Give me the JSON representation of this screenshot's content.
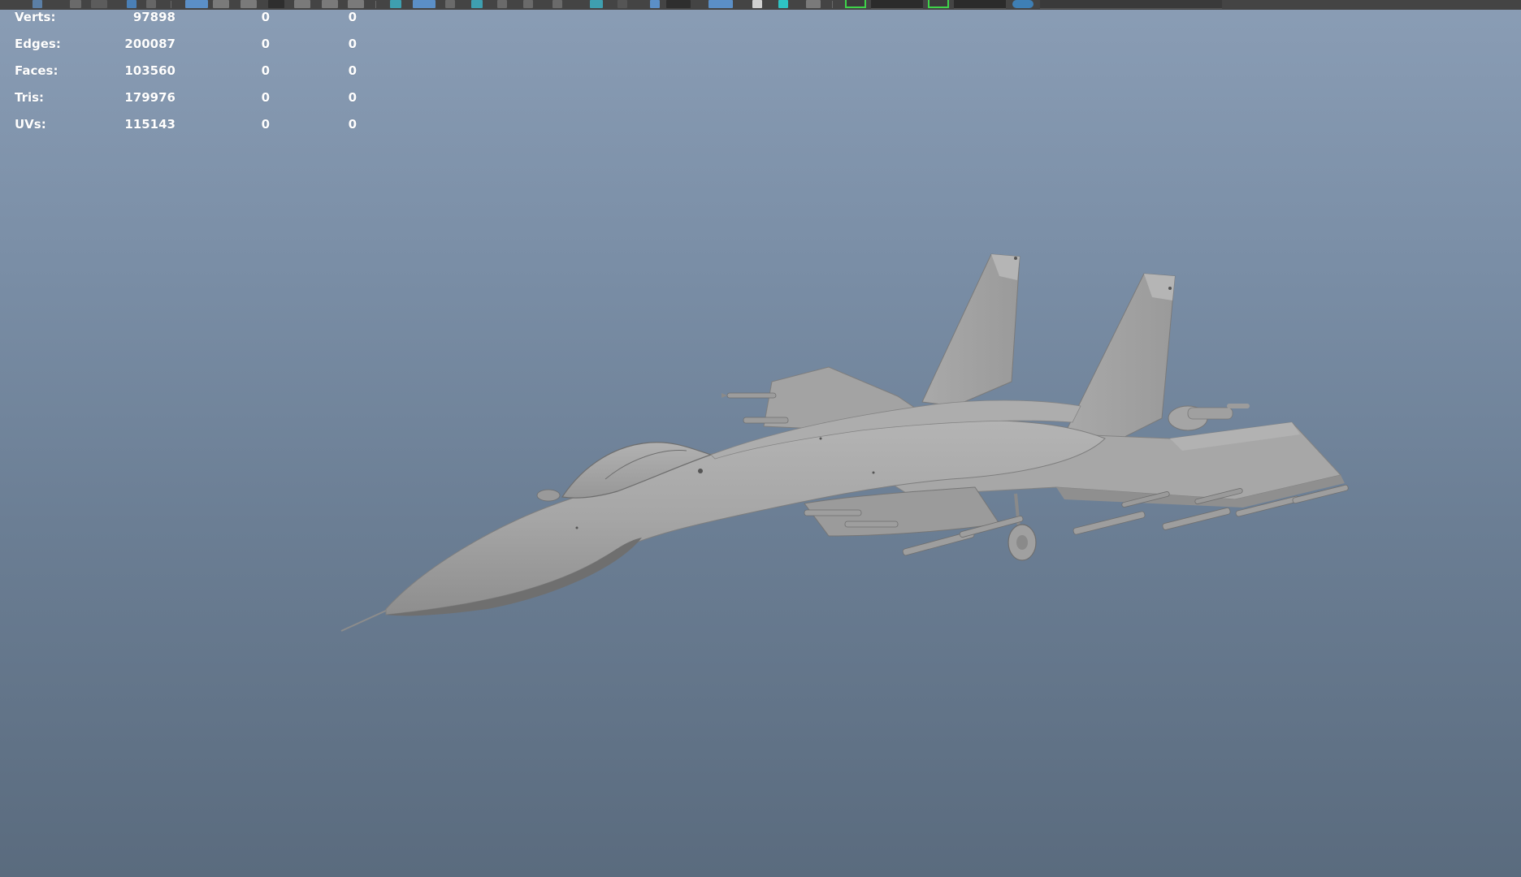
{
  "hud": {
    "rows": [
      {
        "label": "Verts:",
        "v1": "97898",
        "v2": "0",
        "v3": "0"
      },
      {
        "label": "Edges:",
        "v1": "200087",
        "v2": "0",
        "v3": "0"
      },
      {
        "label": "Faces:",
        "v1": "103560",
        "v2": "0",
        "v3": "0"
      },
      {
        "label": "Tris:",
        "v1": "179976",
        "v2": "0",
        "v3": "0"
      },
      {
        "label": "UVs:",
        "v1": "115143",
        "v2": "0",
        "v3": "0"
      }
    ]
  },
  "colors": {
    "viewport_top": "#8a9db5",
    "viewport_bottom": "#5a6b7e",
    "toolbar_bg": "#444444",
    "accent_blue": "#5b8fc7",
    "accent_green": "#3fd34a",
    "model_grey": "#a8a8a8"
  },
  "icons": [
    "move-icon",
    "rotate-icon",
    "scale-icon",
    "select-icon",
    "grid-icon",
    "camera-icon",
    "render-icon",
    "snap-icon",
    "wireframe-icon",
    "shaded-icon"
  ]
}
